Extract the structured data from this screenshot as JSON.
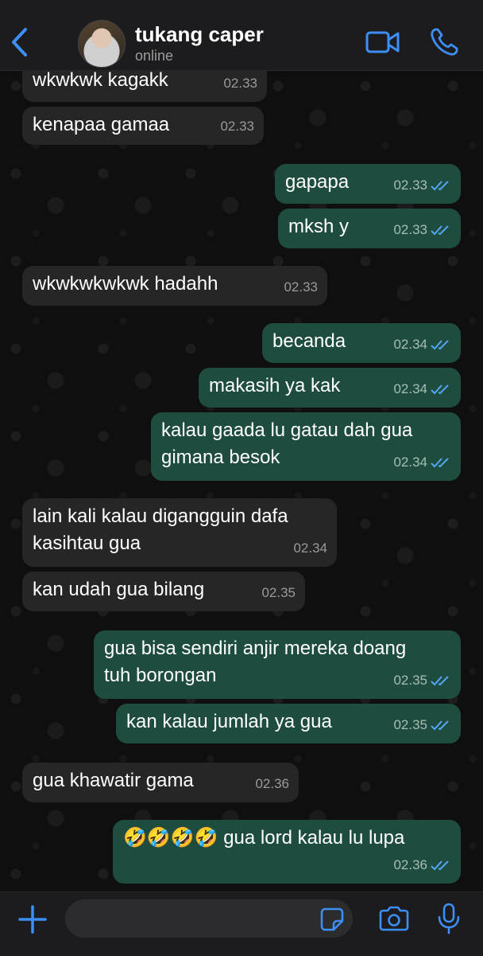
{
  "header": {
    "contact_name": "tukang caper",
    "status": "online",
    "icons": {
      "back": "chevron-left-icon",
      "video": "video-camera-icon",
      "call": "phone-icon"
    },
    "accent_color": "#3d8ef5"
  },
  "messages": [
    {
      "direction": "in",
      "text": "wkwkwk kagakk",
      "time": "02.33"
    },
    {
      "direction": "in",
      "text": "kenapaa gamaa",
      "time": "02.33"
    },
    {
      "direction": "out",
      "text": "gapapa",
      "time": "02.33",
      "status": "read"
    },
    {
      "direction": "out",
      "text": "mksh y",
      "time": "02.33",
      "status": "read"
    },
    {
      "direction": "in",
      "text": "wkwkwkwkwk hadahh",
      "time": "02.33"
    },
    {
      "direction": "out",
      "text": "becanda",
      "time": "02.34",
      "status": "read"
    },
    {
      "direction": "out",
      "text": "makasih ya kak",
      "time": "02.34",
      "status": "read"
    },
    {
      "direction": "out",
      "text": "kalau gaada lu gatau dah gua\ngimana besok",
      "time": "02.34",
      "status": "read"
    },
    {
      "direction": "in",
      "text": "lain kali kalau digangguin dafa\nkasihtau gua",
      "time": "02.34"
    },
    {
      "direction": "in",
      "text": "kan udah gua bilang",
      "time": "02.35"
    },
    {
      "direction": "out",
      "text": "gua bisa sendiri anjir mereka doang\ntuh borongan",
      "time": "02.35",
      "status": "read"
    },
    {
      "direction": "out",
      "text": "kan kalau jumlah ya gua",
      "time": "02.35",
      "status": "read"
    },
    {
      "direction": "in",
      "text": "gua khawatir gama",
      "time": "02.36"
    },
    {
      "direction": "out",
      "text": "🤣🤣🤣🤣 gua lord kalau lu lupa",
      "time": "02.36",
      "status": "read"
    }
  ],
  "composer": {
    "placeholder": "",
    "icons": {
      "add": "plus-icon",
      "sticker": "sticker-icon",
      "camera": "camera-icon",
      "mic": "microphone-icon"
    }
  },
  "colors": {
    "incoming_bubble": "#262626",
    "outgoing_bubble": "#1e4c3f",
    "read_ticks": "#53a6f0"
  }
}
